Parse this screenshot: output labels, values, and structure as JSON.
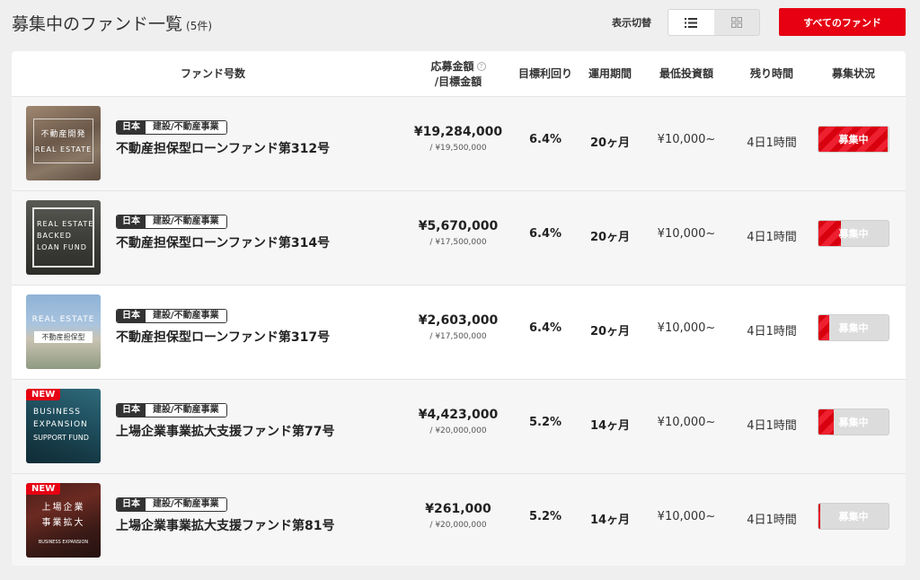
{
  "header": {
    "title": "募集中のファンド一覧",
    "count": "(5件)",
    "view_label": "表示切替",
    "all_funds_label": "すべてのファンド"
  },
  "columns": {
    "fund_number": "ファンド号数",
    "amount_line1": "応募金額",
    "amount_line2": "/目標金額",
    "yield": "目標利回り",
    "period": "運用期間",
    "min_investment": "最低投資額",
    "time_left": "残り時間",
    "status": "募集状況"
  },
  "colors": {
    "accent": "#e60012",
    "tag_dark": "#333333"
  },
  "funds": [
    {
      "thumb_text": [
        "不動産開発",
        "REAL ESTATE"
      ],
      "is_new": false,
      "country": "日本",
      "category": "建設/不動産事業",
      "name": "不動産担保型ローンファンド第312号",
      "amount": "¥19,284,000",
      "target": "/ ¥19,500,000",
      "yield": "6.4%",
      "period": "20ヶ月",
      "min_investment": "¥10,000~",
      "time_left": "4日1時間",
      "status": "募集中",
      "progress": 0.99
    },
    {
      "thumb_text": [
        "REAL ESTATE",
        "BACKED",
        "LOAN FUND"
      ],
      "is_new": false,
      "country": "日本",
      "category": "建設/不動産事業",
      "name": "不動産担保型ローンファンド第314号",
      "amount": "¥5,670,000",
      "target": "/ ¥17,500,000",
      "yield": "6.4%",
      "period": "20ヶ月",
      "min_investment": "¥10,000~",
      "time_left": "4日1時間",
      "status": "募集中",
      "progress": 0.32
    },
    {
      "thumb_text": [
        "REAL ESTATE",
        "不動産担保型"
      ],
      "is_new": false,
      "country": "日本",
      "category": "建設/不動産事業",
      "name": "不動産担保型ローンファンド第317号",
      "amount": "¥2,603,000",
      "target": "/ ¥17,500,000",
      "yield": "6.4%",
      "period": "20ヶ月",
      "min_investment": "¥10,000~",
      "time_left": "4日1時間",
      "status": "募集中",
      "progress": 0.15
    },
    {
      "thumb_text": [
        "BUSINESS",
        "EXPANSION",
        "SUPPORT FUND"
      ],
      "is_new": true,
      "new_label": "NEW",
      "country": "日本",
      "category": "建設/不動産事業",
      "name": "上場企業事業拡大支援ファンド第77号",
      "amount": "¥4,423,000",
      "target": "/ ¥20,000,000",
      "yield": "5.2%",
      "period": "14ヶ月",
      "min_investment": "¥10,000~",
      "time_left": "4日1時間",
      "status": "募集中",
      "progress": 0.22
    },
    {
      "thumb_text": [
        "上場企業",
        "事業拡大",
        "BUSINESS EXPANSION"
      ],
      "is_new": true,
      "new_label": "NEW",
      "country": "日本",
      "category": "建設/不動産事業",
      "name": "上場企業事業拡大支援ファンド第81号",
      "amount": "¥261,000",
      "target": "/ ¥20,000,000",
      "yield": "5.2%",
      "period": "14ヶ月",
      "min_investment": "¥10,000~",
      "time_left": "4日1時間",
      "status": "募集中",
      "progress": 0.02
    }
  ]
}
